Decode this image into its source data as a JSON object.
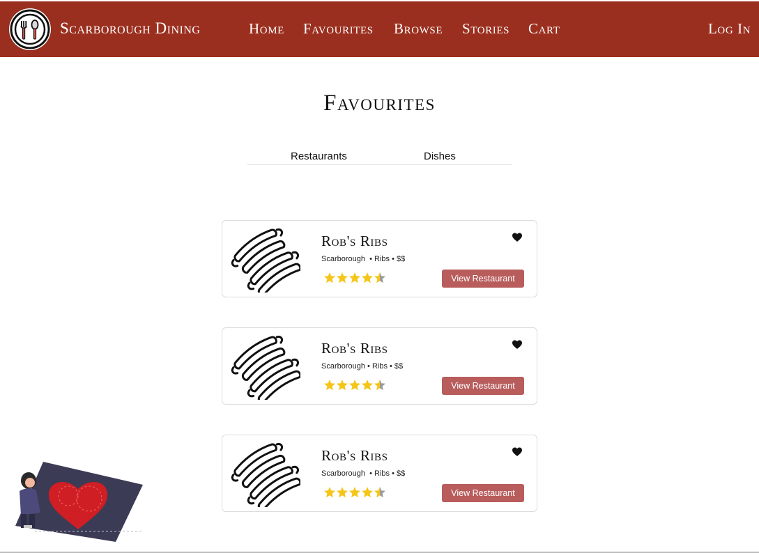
{
  "nav": {
    "brand": "Scarborough Dining",
    "links": [
      "Home",
      "Favourites",
      "Browse",
      "Stories",
      "Cart"
    ],
    "login": "Log In"
  },
  "page": {
    "title": "Favourites",
    "tabs": [
      "Restaurants",
      "Dishes"
    ]
  },
  "restaurants": [
    {
      "name": "Rob's Ribs",
      "meta": "Scarborough  • Ribs • $$",
      "rating": 4.5,
      "button": "View Restaurant",
      "favourited": true
    },
    {
      "name": "Rob's Ribs",
      "meta": "Scarborough • Ribs • $$",
      "rating": 4.5,
      "button": "View Restaurant",
      "favourited": true
    },
    {
      "name": "Rob's Ribs",
      "meta": "Scarborough  • Ribs • $$",
      "rating": 4.5,
      "button": "View Restaurant",
      "favourited": true
    }
  ],
  "colors": {
    "nav_bg": "#9b2f1f",
    "button_bg": "#b85c5c",
    "star": "#f5c518",
    "heart": "#111111"
  },
  "icons": [
    "fork-spoon-logo-icon",
    "ribs-icon",
    "heart-icon",
    "star-icon"
  ]
}
